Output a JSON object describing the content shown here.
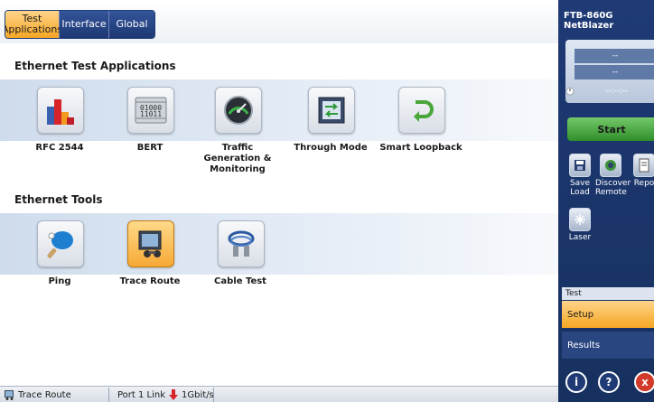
{
  "tabs": [
    {
      "label": "Test Applications",
      "active": true
    },
    {
      "label": "Interface",
      "active": false
    },
    {
      "label": "Global",
      "active": false
    }
  ],
  "sections": {
    "ethernet_test_apps": "Ethernet Test Applications",
    "ethernet_tools": "Ethernet Tools"
  },
  "test_apps": [
    {
      "label": "RFC 2544",
      "icon": "bar-chart-icon"
    },
    {
      "label": "BERT",
      "icon": "binary-digits-icon"
    },
    {
      "label": "Traffic Generation & Monitoring",
      "icon": "gauge-icon"
    },
    {
      "label": "Through Mode",
      "icon": "through-mode-icon"
    },
    {
      "label": "Smart Loopback",
      "icon": "loopback-arrow-icon"
    }
  ],
  "tools": [
    {
      "label": "Ping",
      "icon": "ping-paddle-icon"
    },
    {
      "label": "Trace Route",
      "icon": "trace-route-icon",
      "selected": true
    },
    {
      "label": "Cable Test",
      "icon": "cable-icon"
    }
  ],
  "status": {
    "app": "Trace Route",
    "port": "Port 1 Link",
    "speed": "1Gbit/s"
  },
  "side": {
    "model": "FTB-860G",
    "product": "NetBlazer",
    "timer1": "--",
    "timer2": "--",
    "clock": "--:--:--",
    "start": "Start",
    "tools": [
      {
        "label1": "Save",
        "label2": "Load",
        "icon": "save-icon"
      },
      {
        "label1": "Discover",
        "label2": "Remote",
        "icon": "discover-icon"
      },
      {
        "label1": "Repo",
        "label2": "",
        "icon": "report-icon"
      },
      {
        "label1": "Laser",
        "label2": "",
        "icon": "laser-icon"
      }
    ],
    "nav_header": "Test",
    "nav": [
      {
        "label": "Setup",
        "active": true
      },
      {
        "label": "Results",
        "active": false
      }
    ],
    "buttons": [
      "i",
      "?",
      "x"
    ]
  },
  "colors": {
    "accent_orange": "#f5a623",
    "nav_blue": "#1f3a75",
    "start_green": "#3a9a34",
    "exit_red": "#d23a2a"
  }
}
